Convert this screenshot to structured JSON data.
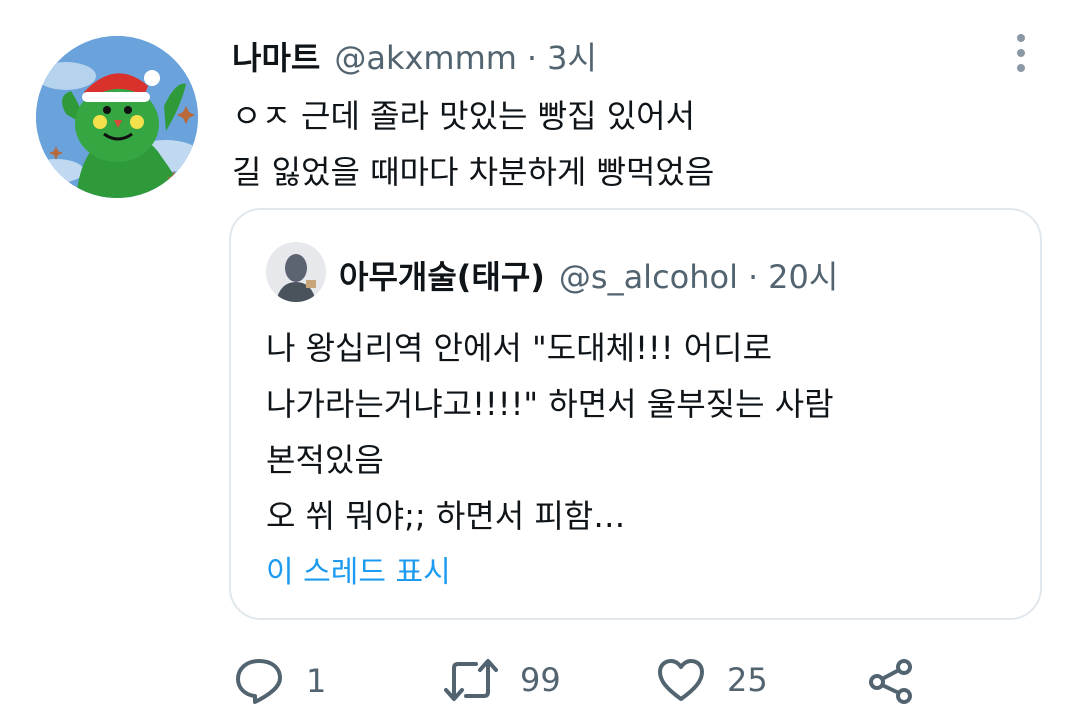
{
  "tweet": {
    "display_name": "나마트",
    "handle": "@akxmmm",
    "separator": "·",
    "time": "3시",
    "text_lines": [
      "ㅇㅈ 근데 졸라 맛있는 빵집 있어서",
      "길 잃었을 때마다 차분하게 빵먹었음"
    ],
    "avatar_icon": "green-mascot-santa-hat-avatar",
    "more_icon": "vertical-dots-icon"
  },
  "quote": {
    "display_name": "아무개술(태구)",
    "handle": "@s_alcohol",
    "separator": "·",
    "time": "20시",
    "text_lines": [
      "나 왕십리역 안에서 \"도대체!!! 어디로",
      "나가라는거냐고!!!!\" 하면서 울부짖는 사람",
      "본적있음",
      "오 쒸 뭐야;; 하면서 피함…"
    ],
    "show_thread": "이 스레드 표시",
    "avatar_icon": "gray-silhouette-avatar"
  },
  "actions": {
    "reply_count": "1",
    "retweet_count": "99",
    "like_count": "25",
    "reply_icon": "reply-bubble-icon",
    "retweet_icon": "retweet-icon",
    "like_icon": "heart-icon",
    "share_icon": "share-icon"
  },
  "colors": {
    "text": "#0f1419",
    "secondary": "#536471",
    "link": "#1d9bf0",
    "border": "#e1e8ed"
  }
}
